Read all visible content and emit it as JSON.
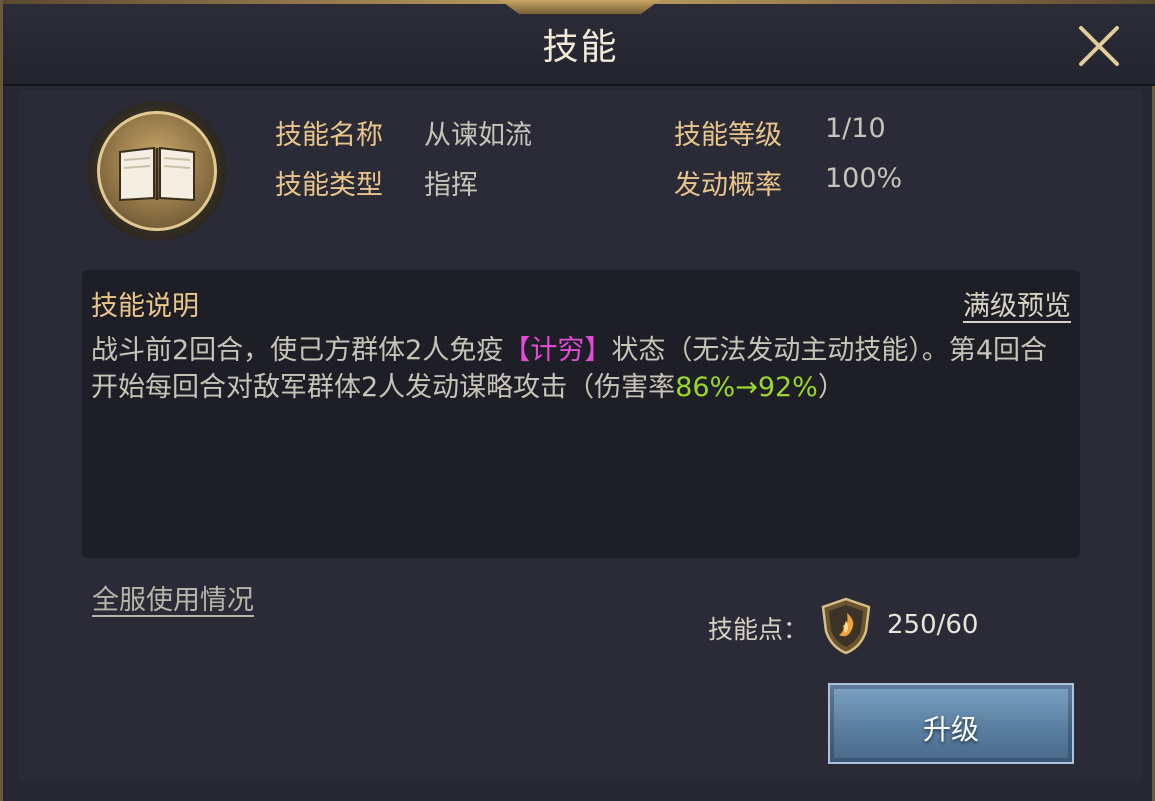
{
  "window": {
    "title": "技能"
  },
  "icons": {
    "close": "close-icon",
    "skill": "book-icon",
    "points": "shield-flame-icon"
  },
  "info": {
    "name_label": "技能名称",
    "name_value": "从谏如流",
    "level_label": "技能等级",
    "level_value": "1/10",
    "type_label": "技能类型",
    "type_value": "指挥",
    "rate_label": "发动概率",
    "rate_value": "100%"
  },
  "description": {
    "title": "技能说明",
    "preview_link": "满级预览",
    "text_part1": "战斗前2回合，使己方群体2人免疫",
    "highlight": "【计穷】",
    "text_part2": "状态（无法发动主动技能）。第4回合开始每回合对敌军群体2人发动谋略攻击（伤害率",
    "damage_change": "86%→92%",
    "text_part3": "）"
  },
  "usage_link": "全服使用情况",
  "skill_points": {
    "label": "技能点：",
    "value": "250/60"
  },
  "upgrade_button": "升级",
  "colors": {
    "gold_label": "#e8c58a",
    "highlight_pink": "#e24bd6",
    "highlight_green": "#9bd62a",
    "button_blue": "#5a7fa0"
  }
}
